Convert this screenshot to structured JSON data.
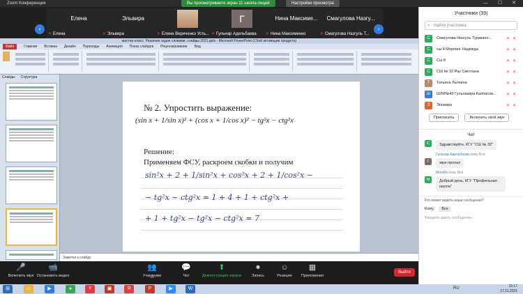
{
  "titlebar": {
    "app": "Zoom Конференция",
    "share": "Вы просматриваете экран 11 школа-лицей",
    "options": "Настройки просмотра",
    "window_controls": "— ☐ ✕"
  },
  "strip": {
    "tiles": [
      {
        "big": "Елена",
        "label": "Елена"
      },
      {
        "big": "Эльвира",
        "label": "Эльвира"
      },
      {
        "big": "",
        "label": "Елена Вериченко Усть..."
      },
      {
        "big": "Г",
        "label": "Гульнар Адельбаева"
      },
      {
        "big": "Нина Максиме...",
        "label": "Нина Максименко"
      },
      {
        "big": "Смагулова Назгу...",
        "label": "Смагулова Назгуль Т..."
      }
    ]
  },
  "ppt": {
    "title": "мастер-класс. Решение задач словами. слайды 2021.pptx - Microsoft PowerPoint (Сбой активации продукта)",
    "tabs": [
      "Файл",
      "Главная",
      "Вставка",
      "Дизайн",
      "Переходы",
      "Анимация",
      "Показ слайдов",
      "Рецензирование",
      "Вид"
    ],
    "pane_tabs": [
      "Слайды",
      "Структура"
    ],
    "notes": "Заметки к слайду"
  },
  "slide": {
    "task_title": "№ 2. Упростить выражение:",
    "formula": "(sin x + 1/sin x)² + (cos x + 1/cos x)² − tg²x − ctg²x",
    "solution_label": "Решение:",
    "solution_text": "Применяем ФСУ, раскроем скобки и получим",
    "hand_lines": [
      "sin²x + 2 + 1/sin²x + cos²x + 2 + 1/cos²x −",
      "− tg²x − ctg²x = 1 + 4 + 1 + ctg²x +",
      "+ 1 + tg²x − tg²x − ctg²x = 7"
    ]
  },
  "toolbar": {
    "buttons": [
      {
        "icon": "🎤",
        "label": "Включить звук"
      },
      {
        "icon": "📹",
        "label": "Остановить видео"
      },
      {
        "icon": "👥",
        "label": "Участники",
        "count": "39"
      },
      {
        "icon": "💬",
        "label": "Чат"
      },
      {
        "icon": "⬆",
        "label": "Демонстрация экрана"
      },
      {
        "icon": "⏺",
        "label": "Запись"
      },
      {
        "icon": "☺",
        "label": "Реакции"
      },
      {
        "icon": "▦",
        "label": "Приложения"
      }
    ],
    "leave": "Выйти"
  },
  "taskbar": {
    "lang": "RU",
    "time": "15:17",
    "date": "17.11.2021"
  },
  "panel": {
    "title": "Участники (39)",
    "search_placeholder": "Найти участника",
    "participants": [
      {
        "initial": "С",
        "color": "#2dae5e",
        "name": "Смагулова Назгуль Туракано..."
      },
      {
        "initial": "С",
        "color": "#2dae5e",
        "name": "сш 4  Морланг Надежда"
      },
      {
        "initial": "С",
        "color": "#2dae5e",
        "name": "Сш 8"
      },
      {
        "initial": "С",
        "color": "#2dae5e",
        "name": "СШ № 32 Рау Светлана"
      },
      {
        "initial": "Т",
        "color": "#b98a6b",
        "name": "Татьяна Лыткина"
      },
      {
        "initial": "Ш",
        "color": "#2f7de1",
        "name": "ШЛИ№43 Гульназира Калпасов..."
      },
      {
        "initial": "Э",
        "color": "#e8612c",
        "name": "Эльвира"
      }
    ],
    "invite": "Пригласить",
    "unmute_self": "Включить свой звук",
    "chat_title": "Чат",
    "messages": [
      {
        "initial": "С",
        "color": "#2dae5e",
        "text": "Здравствуйте, КГУ \"СШ № 32\"",
        "from": "",
        "to": ""
      },
      {
        "initial": "Г",
        "color": "#7b6c6c",
        "text": "звук пропал",
        "from": "Гульнар Адельбаева",
        "to": "кому Все"
      },
      {
        "initial": "М",
        "color": "#2dae5e",
        "text": "Добрый день, КГУ \"Профильная школа\"",
        "from": "Мягиба",
        "to": "кому Все"
      }
    ],
    "file_question": "Кто может видеть ваши сообщения?",
    "to_label": "Кому:",
    "to_value": "Все",
    "input_placeholder": "Введите здесь сообщение..."
  }
}
